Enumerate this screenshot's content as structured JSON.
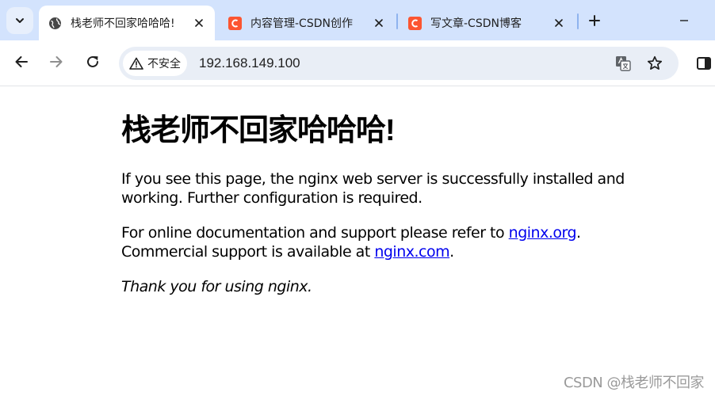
{
  "tabs": [
    {
      "title": "栈老师不回家哈哈哈!",
      "favicon": "globe-icon",
      "active": true
    },
    {
      "title": "内容管理-CSDN创作",
      "favicon": "csdn-icon",
      "active": false
    },
    {
      "title": "写文章-CSDN博客",
      "favicon": "csdn-icon",
      "active": false
    }
  ],
  "toolbar": {
    "security_label": "不安全",
    "url": "192.168.149.100"
  },
  "page": {
    "heading": "栈老师不回家哈哈哈!",
    "para1": "If you see this page, the nginx web server is successfully installed and working. Further configuration is required.",
    "para2_prefix": "For online documentation and support please refer to ",
    "link1": "nginx.org",
    "para2_mid": "Commercial support is available at ",
    "link2": "nginx.com",
    "period": ".",
    "thanks": "Thank you for using nginx."
  },
  "watermark": "CSDN @栈老师不回家",
  "colors": {
    "tabstrip": "#d3e3fd",
    "omnibox": "#e9eef6",
    "link": "#0000ee",
    "csdn_brand": "#fc5531"
  }
}
